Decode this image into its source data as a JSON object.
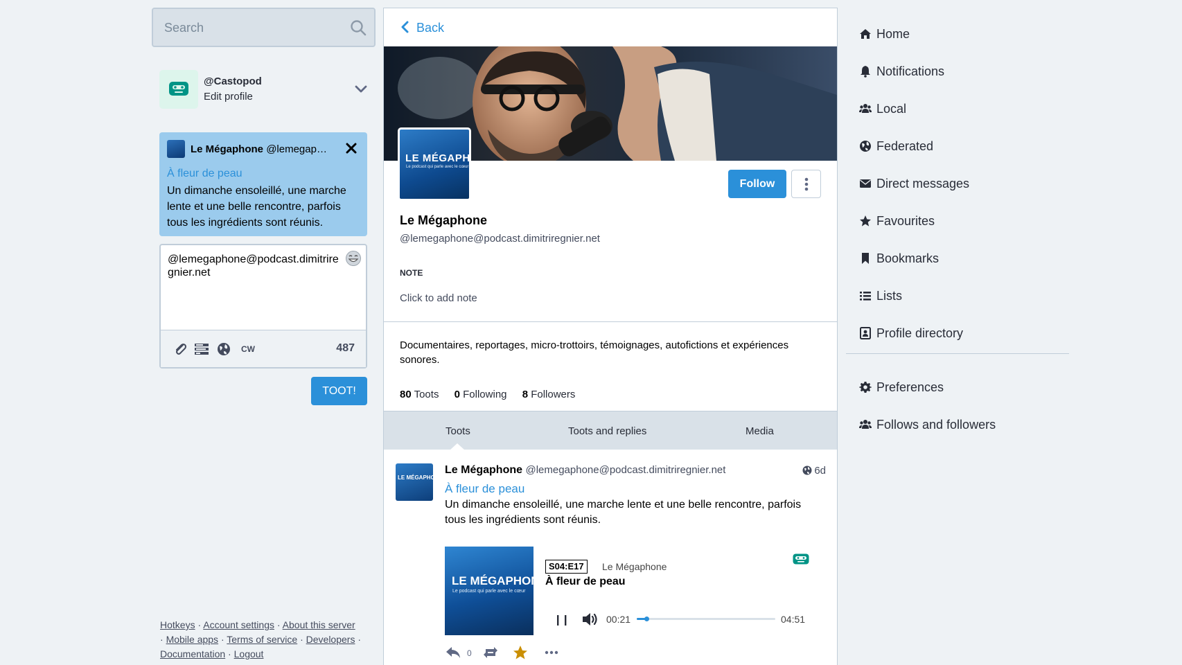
{
  "search": {
    "placeholder": "Search"
  },
  "account": {
    "handle": "@Castopod",
    "edit_label": "Edit profile"
  },
  "reply_preview": {
    "display_name": "Le Mégaphone",
    "acct": "@lemegap…",
    "link": "À fleur de peau",
    "text": "Un dimanche ensoleillé, une marche lente et une belle rencontre, parfois tous les ingrédients sont réunis."
  },
  "compose": {
    "text": "@lemegaphone@podcast.dimitriregnier.net",
    "cw_label": "CW",
    "char_count": "487",
    "submit_label": "TOOT!"
  },
  "footer": {
    "links": [
      "Hotkeys",
      "Account settings",
      "About this server",
      "Mobile apps",
      "Terms of service",
      "Developers",
      "Documentation",
      "Logout"
    ]
  },
  "header": {
    "back_label": "Back"
  },
  "profile": {
    "avatar_title": "LE MÉGAPHONE",
    "avatar_subtitle": "Le podcast qui parle avec le cœur",
    "display_name": "Le Mégaphone",
    "acct": "@lemegaphone@podcast.dimitriregnier.net",
    "follow_label": "Follow",
    "note_label": "NOTE",
    "note_placeholder": "Click to add note",
    "bio": "Documentaires, reportages, micro-trottoirs, témoignages, autofictions et expériences sonores.",
    "stats": {
      "toots_count": "80",
      "toots_label": "Toots",
      "following_count": "0",
      "following_label": "Following",
      "followers_count": "8",
      "followers_label": "Followers"
    },
    "tabs": [
      "Toots",
      "Toots and replies",
      "Media"
    ]
  },
  "status": {
    "avatar_text": "LE MÉGAPHONE",
    "display_name": "Le Mégaphone",
    "acct": "@lemegaphone@podcast.dimitriregnier.net",
    "time": "6d",
    "link": "À fleur de peau",
    "text": "Un dimanche ensoleillé, une marche lente et une belle rencontre, parfois tous les ingrédients sont réunis.",
    "player": {
      "cover_title": "LE MÉGAPHONE",
      "cover_subtitle": "Le podcast qui parle avec le cœur",
      "episode": "S04:E17",
      "show": "Le Mégaphone",
      "title": "À fleur de peau",
      "current_time": "00:21",
      "duration": "04:51",
      "progress": 0.07
    },
    "reply_count": "0",
    "accent_favourite": "#ca8f04"
  },
  "nav": {
    "items": [
      {
        "label": "Home",
        "icon": "home-icon"
      },
      {
        "label": "Notifications",
        "icon": "bell-icon"
      },
      {
        "label": "Local",
        "icon": "users-icon"
      },
      {
        "label": "Federated",
        "icon": "globe-icon"
      },
      {
        "label": "Direct messages",
        "icon": "envelope-icon"
      },
      {
        "label": "Favourites",
        "icon": "star-icon"
      },
      {
        "label": "Bookmarks",
        "icon": "bookmark-icon"
      },
      {
        "label": "Lists",
        "icon": "list-icon"
      },
      {
        "label": "Profile directory",
        "icon": "address-book-icon"
      }
    ],
    "secondary": [
      {
        "label": "Preferences",
        "icon": "gear-icon"
      },
      {
        "label": "Follows and followers",
        "icon": "users-icon"
      }
    ]
  },
  "colors": {
    "accent": "#2b90d9",
    "background": "#eef2f5",
    "reply_bg": "#9bcbed",
    "castopod_green": "#009486"
  }
}
